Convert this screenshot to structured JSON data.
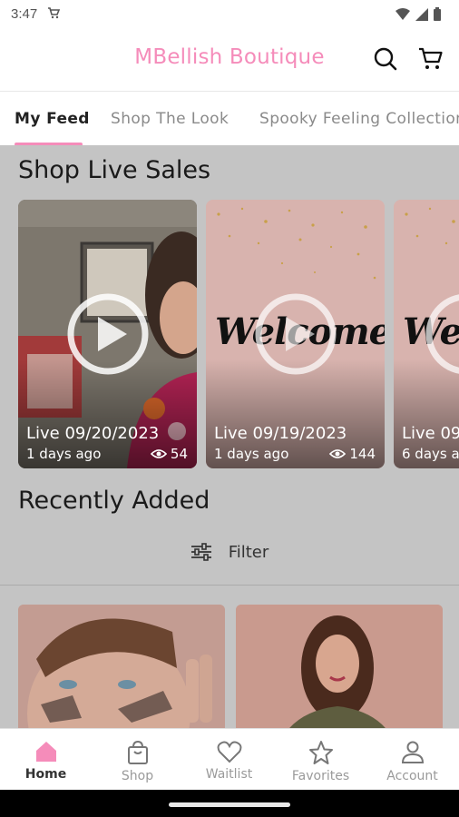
{
  "status_bar": {
    "time": "3:47"
  },
  "app_bar": {
    "title": "MBellish Boutique",
    "brand_color": "#f58cba"
  },
  "tabs": [
    {
      "label": "My Feed",
      "active": true
    },
    {
      "label": "Shop The Look",
      "active": false
    },
    {
      "label": "Spooky Feeling Collection",
      "active": false
    }
  ],
  "live_sales": {
    "heading": "Shop Live Sales",
    "cards": [
      {
        "title": "Live 09/20/2023",
        "ago": "1 days ago",
        "views": "54"
      },
      {
        "title": "Live 09/19/2023",
        "ago": "1 days ago",
        "views": "144",
        "overlay_text": "Welcome"
      },
      {
        "title": "Live 09/",
        "ago": "6 days a",
        "overlay_text": "We"
      }
    ]
  },
  "recently_added": {
    "heading": "Recently Added",
    "filter_label": "Filter"
  },
  "bottom_nav": [
    {
      "label": "Home",
      "icon": "home-icon",
      "active": true
    },
    {
      "label": "Shop",
      "icon": "shopping-bag-icon",
      "active": false
    },
    {
      "label": "Waitlist",
      "icon": "heart-icon",
      "active": false
    },
    {
      "label": "Favorites",
      "icon": "star-icon",
      "active": false
    },
    {
      "label": "Account",
      "icon": "person-icon",
      "active": false
    }
  ]
}
